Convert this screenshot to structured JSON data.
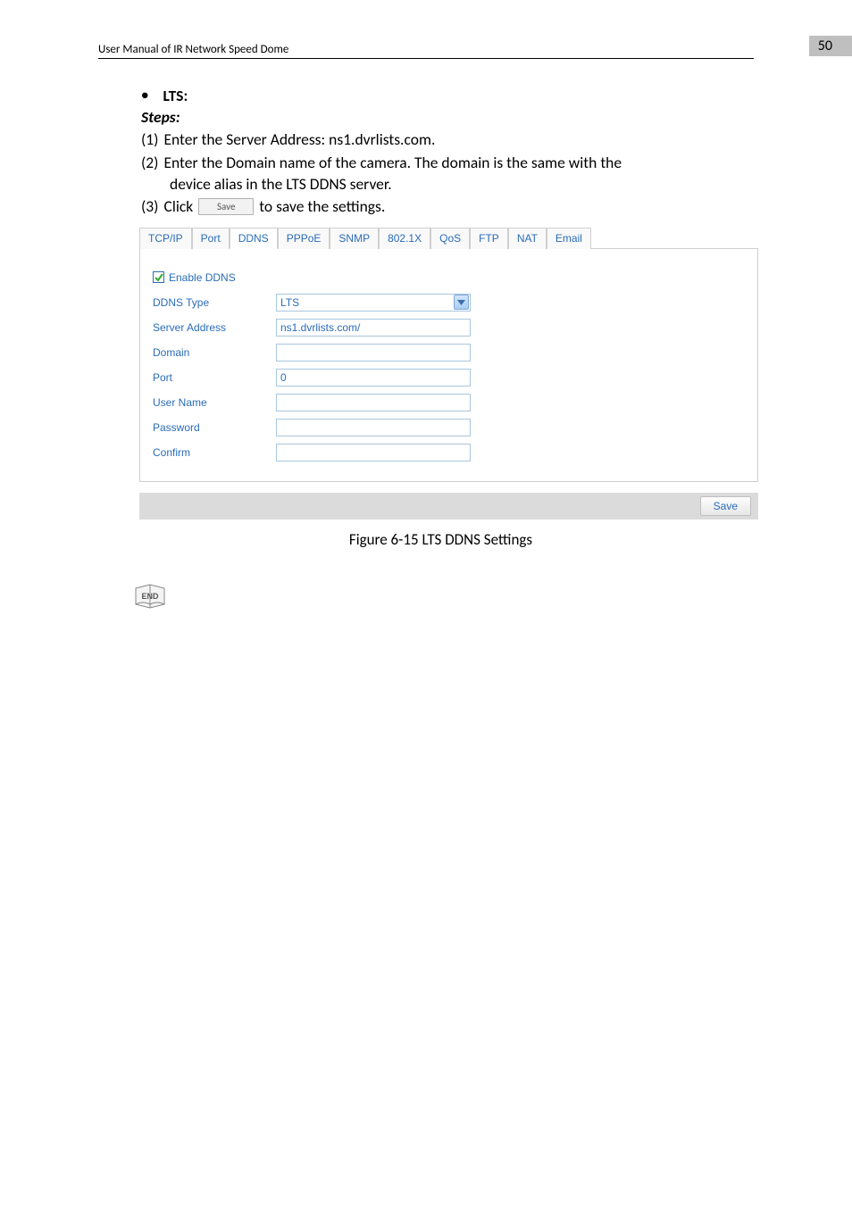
{
  "header": {
    "left": "User Manual of IR Network Speed Dome",
    "page_no": "50"
  },
  "bullet_title": "LTS:",
  "steps_label": "Steps:",
  "steps": [
    {
      "n": "(1)",
      "text": "Enter the Server Address: ns1.dvrlists.com."
    },
    {
      "n": "(2)",
      "text": "Enter the Domain name of the camera. The domain is the same with the",
      "sub": "device alias in the LTS DDNS server."
    },
    {
      "n": "(3)",
      "before": "Click",
      "btn": "Save",
      "after": "to save the settings."
    }
  ],
  "tabs": [
    "TCP/IP",
    "Port",
    "DDNS",
    "PPPoE",
    "SNMP",
    "802.1X",
    "QoS",
    "FTP",
    "NAT",
    "Email"
  ],
  "active_tab_index": 2,
  "form": {
    "enable_label": "Enable DDNS",
    "rows": {
      "ddns_type": {
        "label": "DDNS Type",
        "value": "LTS"
      },
      "server_address": {
        "label": "Server Address",
        "value": "ns1.dvrlists.com/"
      },
      "domain": {
        "label": "Domain",
        "value": ""
      },
      "port": {
        "label": "Port",
        "value": "0"
      },
      "user_name": {
        "label": "User Name",
        "value": ""
      },
      "password": {
        "label": "Password",
        "value": ""
      },
      "confirm": {
        "label": "Confirm",
        "value": ""
      }
    }
  },
  "save_button": "Save",
  "figure_caption": "Figure 6-15 LTS DDNS Settings"
}
